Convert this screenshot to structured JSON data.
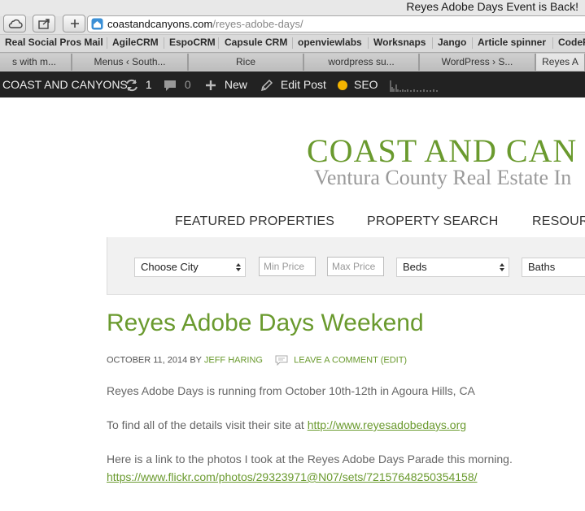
{
  "browser": {
    "window_title": "Reyes Adobe Days Event is Back!",
    "url_domain": "coastandcanyons.com",
    "url_path": "/reyes-adobe-days/",
    "bookmarks": [
      "Real Social Pros Mail",
      "AgileCRM",
      "EspoCRM",
      "Capsule CRM",
      "openviewlabs",
      "Worksnaps",
      "Jango",
      "Article spinner",
      "CodeF"
    ],
    "tabs": [
      "s with m...",
      "Menus ‹ South...",
      "Rice",
      "wordpress su...",
      "WordPress › S...",
      "Reyes A"
    ]
  },
  "adminbar": {
    "site_name": "COAST AND CANYONS",
    "updates_count": "1",
    "comments_count": "0",
    "new_label": "New",
    "edit_label": "Edit Post",
    "seo_label": "SEO"
  },
  "site": {
    "title": "COAST AND CAN",
    "tagline": "Ventura County Real Estate In",
    "nav": [
      "FEATURED PROPERTIES",
      "PROPERTY SEARCH",
      "RESOUR"
    ]
  },
  "search": {
    "city_select": "Choose City",
    "min_price_placeholder": "Min Price",
    "max_price_placeholder": "Max Price",
    "beds_select": "Beds",
    "baths_select": "Baths"
  },
  "post": {
    "title": "Reyes Adobe Days Weekend",
    "date": "OCTOBER 11, 2014",
    "by": "BY",
    "author": "JEFF HARING",
    "comment_link": "LEAVE A COMMENT",
    "edit_link": "(EDIT)",
    "para1": "Reyes Adobe Days is running from October 10th-12th in Agoura Hills, CA",
    "para2_text": "To find all of the details visit their site at",
    "para2_link": "http://www.reyesadobedays.org",
    "para3_text": "Here is a link to the photos I took at the Reyes Adobe Days Parade this morning.",
    "para3_link": "https://www.flickr.com/photos/29323971@N07/sets/72157648250354158/"
  },
  "colors": {
    "accent_green": "#6a9a2e",
    "admin_bar": "#222222",
    "seo_dot": "#f4b400"
  }
}
